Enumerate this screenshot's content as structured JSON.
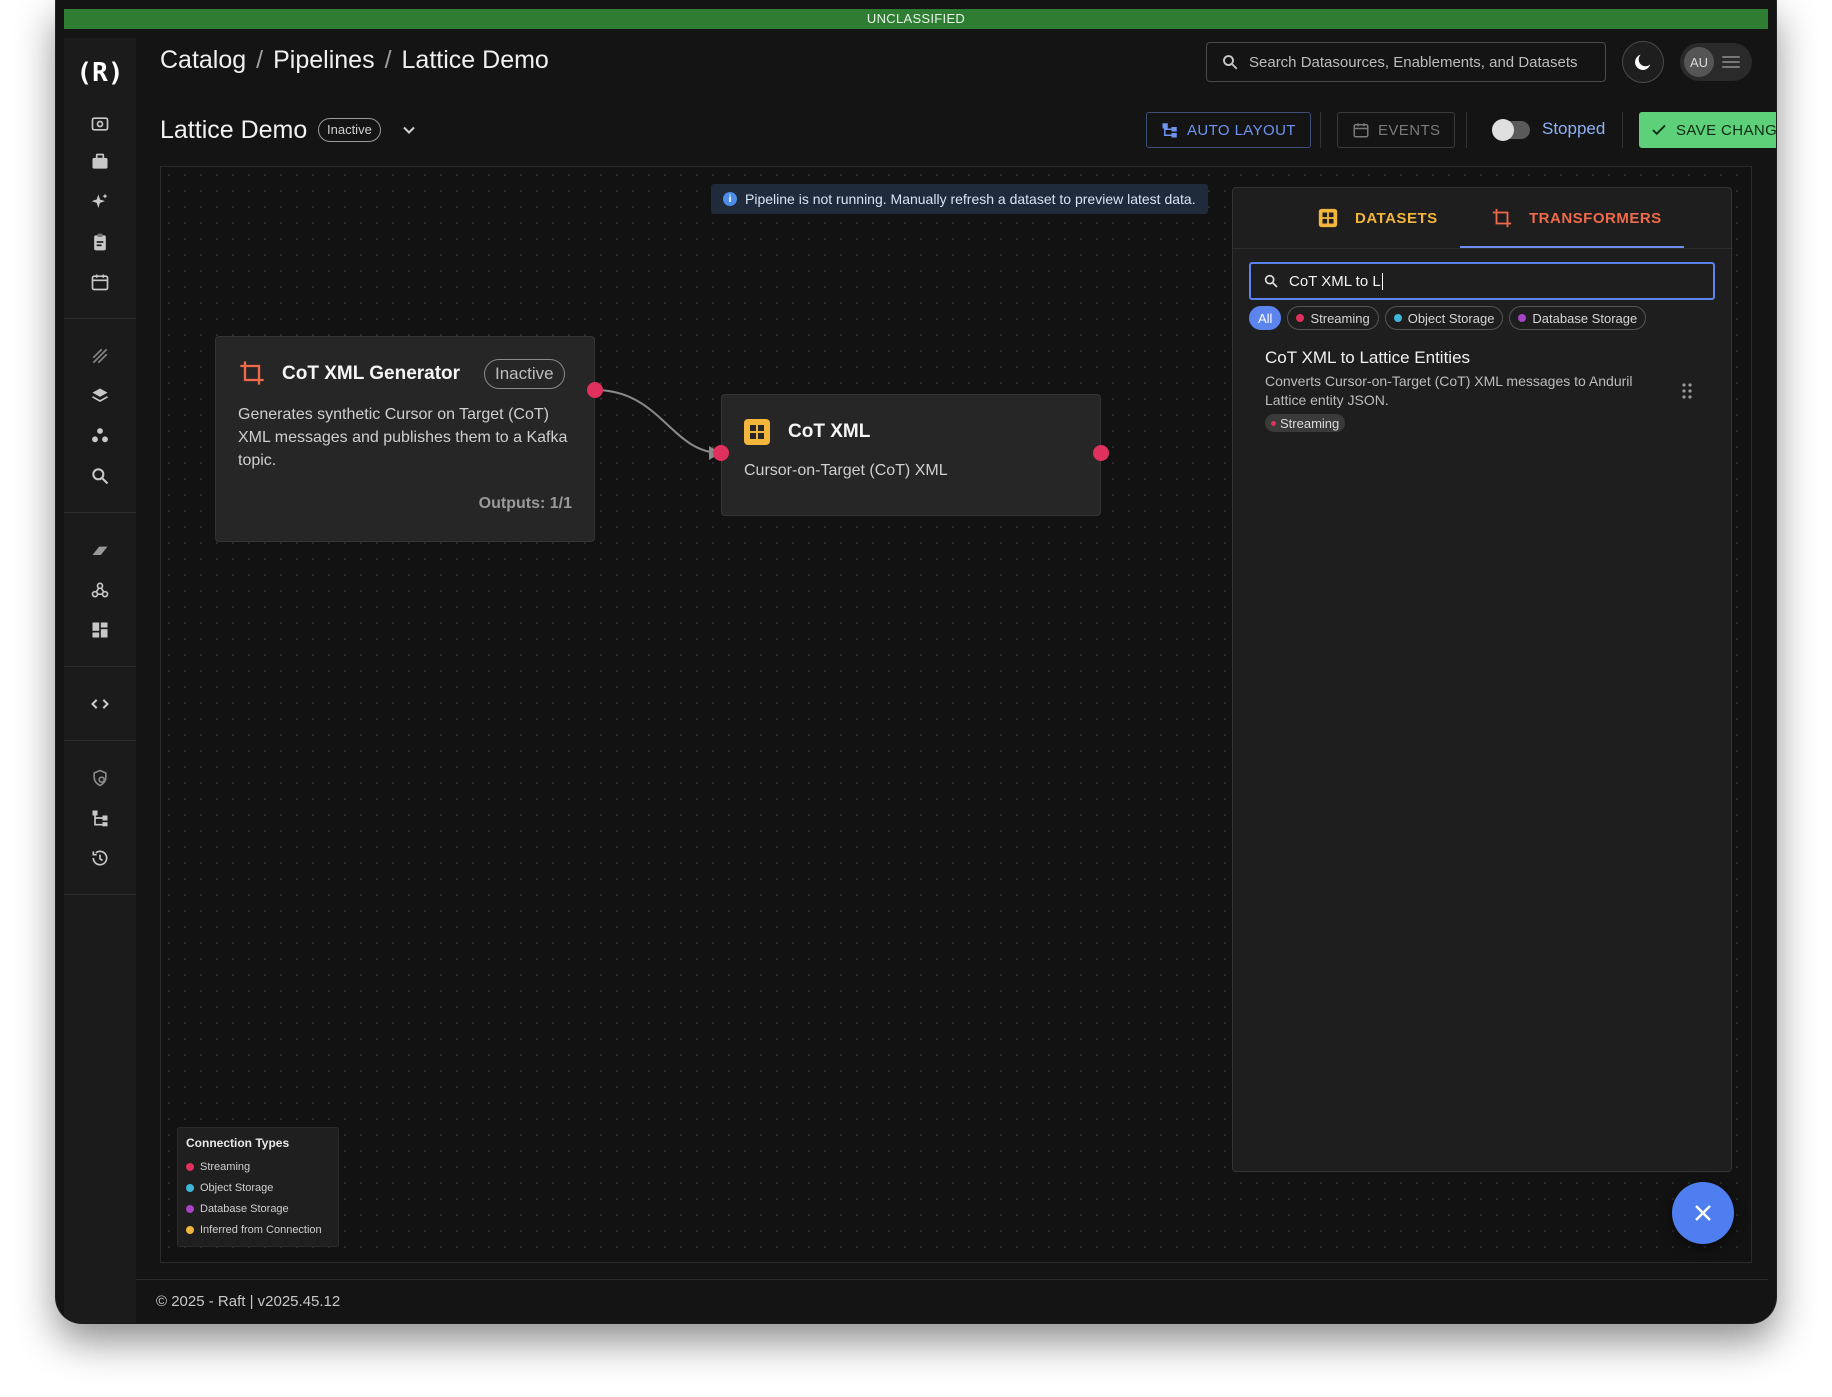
{
  "classification": "UNCLASSIFIED",
  "logo": "(R)",
  "breadcrumb": {
    "items": [
      "Catalog",
      "Pipelines",
      "Lattice Demo"
    ],
    "separator": "/"
  },
  "search": {
    "placeholder": "Search Datasources, Enablements, and Datasets"
  },
  "user": {
    "initials": "AU"
  },
  "pipeline": {
    "title": "Lattice Demo",
    "status": "Inactive"
  },
  "toolbar": {
    "auto_layout": "AUTO LAYOUT",
    "events": "EVENTS",
    "run_state": "Stopped",
    "save": "SAVE CHANGES"
  },
  "banner": {
    "text": "Pipeline is not running. Manually refresh a dataset to preview latest data."
  },
  "nodes": {
    "generator": {
      "title": "CoT XML Generator",
      "status": "Inactive",
      "description": "Generates synthetic Cursor on Target (CoT) XML messages and publishes them to a Kafka topic.",
      "outputs": "Outputs: 1/1"
    },
    "dataset": {
      "title": "CoT XML",
      "description": "Cursor-on-Target (CoT) XML"
    }
  },
  "legend": {
    "title": "Connection Types",
    "items": [
      {
        "label": "Streaming",
        "color": "#e0315c"
      },
      {
        "label": "Object Storage",
        "color": "#3fb6d8"
      },
      {
        "label": "Database Storage",
        "color": "#a744c8"
      },
      {
        "label": "Inferred from Connection",
        "color": "#f3b63d"
      }
    ]
  },
  "panel": {
    "tabs": {
      "datasets": "DATASETS",
      "transformers": "TRANSFORMERS"
    },
    "search_value": "CoT XML to L",
    "filters": [
      {
        "label": "All",
        "color": ""
      },
      {
        "label": "Streaming",
        "color": "#e0315c"
      },
      {
        "label": "Object Storage",
        "color": "#3fb6d8"
      },
      {
        "label": "Database Storage",
        "color": "#a744c8"
      }
    ],
    "result": {
      "title": "CoT XML to Lattice Entities",
      "description": "Converts Cursor-on-Target (CoT) XML messages to Anduril Lattice entity JSON.",
      "tag": "Streaming"
    }
  },
  "colors": {
    "accent": "#5b84ef",
    "save": "#5fd07a",
    "transformer": "#ef6a4a",
    "dataset": "#f3b63d",
    "streaming": "#e0315c"
  },
  "footer": {
    "text": "© 2025 - Raft  | v2025.45.12"
  }
}
